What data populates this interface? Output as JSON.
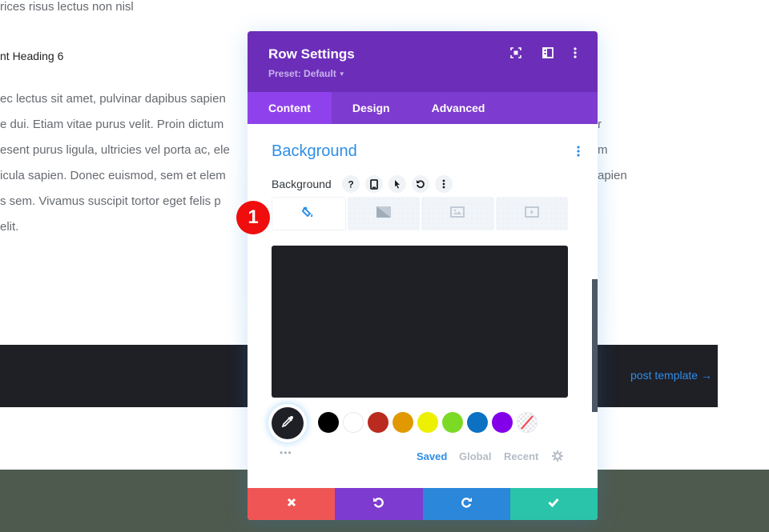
{
  "page": {
    "text_lines": [
      "rices risus lectus non nisl",
      "ec lectus sit amet, pulvinar dapibus sapien",
      "e dui. Etiam vitae purus velit. Proin dictum",
      "esent purus ligula, ultricies vel porta ac, ele",
      "icula sapien. Donec euismod, sem et elem",
      "s sem. Vivamus suscipit tortor eget felis p",
      " elit."
    ],
    "right_fragments": [
      "r",
      "m",
      "apien"
    ],
    "heading": "nt Heading 6",
    "post_link": "post template →",
    "colors": {
      "dark_band": "#1f1f26",
      "green_band": "#4f5a4e",
      "link": "#2e8ee6"
    }
  },
  "modal": {
    "title": "Row Settings",
    "preset_label": "Preset: Default",
    "header_icons": [
      "fullscreen-icon",
      "sidebar-toggle-icon",
      "more-vertical-icon"
    ],
    "tabs": [
      {
        "label": "Content",
        "active": true
      },
      {
        "label": "Design",
        "active": false
      },
      {
        "label": "Advanced",
        "active": false
      }
    ],
    "section_title": "Background",
    "field_label": "Background",
    "field_options": [
      "help-icon",
      "responsive-phone-icon",
      "hover-pointer-icon",
      "reset-icon",
      "more-vertical-icon"
    ],
    "background_types": [
      {
        "name": "color",
        "icon": "paint-bucket-icon",
        "active": true
      },
      {
        "name": "gradient",
        "icon": "gradient-icon",
        "active": false
      },
      {
        "name": "image",
        "icon": "image-icon",
        "active": false
      },
      {
        "name": "video",
        "icon": "video-icon",
        "active": false
      }
    ],
    "current_color": "#1f1f26",
    "swatches": [
      "#000000",
      "#ffffff",
      "#bb2a1f",
      "#e09900",
      "#edf000",
      "#7cda24",
      "#0c71c3",
      "#8300e9",
      "transparent"
    ],
    "palette_tabs": [
      {
        "label": "Saved",
        "active": true
      },
      {
        "label": "Global",
        "active": false
      },
      {
        "label": "Recent",
        "active": false
      }
    ],
    "footer_buttons": [
      {
        "name": "discard",
        "icon": "close-icon",
        "color": "#ef5555"
      },
      {
        "name": "undo",
        "icon": "undo-icon",
        "color": "#7e3bd0"
      },
      {
        "name": "redo",
        "icon": "redo-icon",
        "color": "#2b87da"
      },
      {
        "name": "save",
        "icon": "check-icon",
        "color": "#29c4a9"
      }
    ],
    "colors": {
      "header": "#6c2eb9",
      "tabs_bar": "#7d3bcf",
      "active_tab": "#8f42ec",
      "accent": "#2e8ee6"
    }
  },
  "annotation_badge": "1"
}
